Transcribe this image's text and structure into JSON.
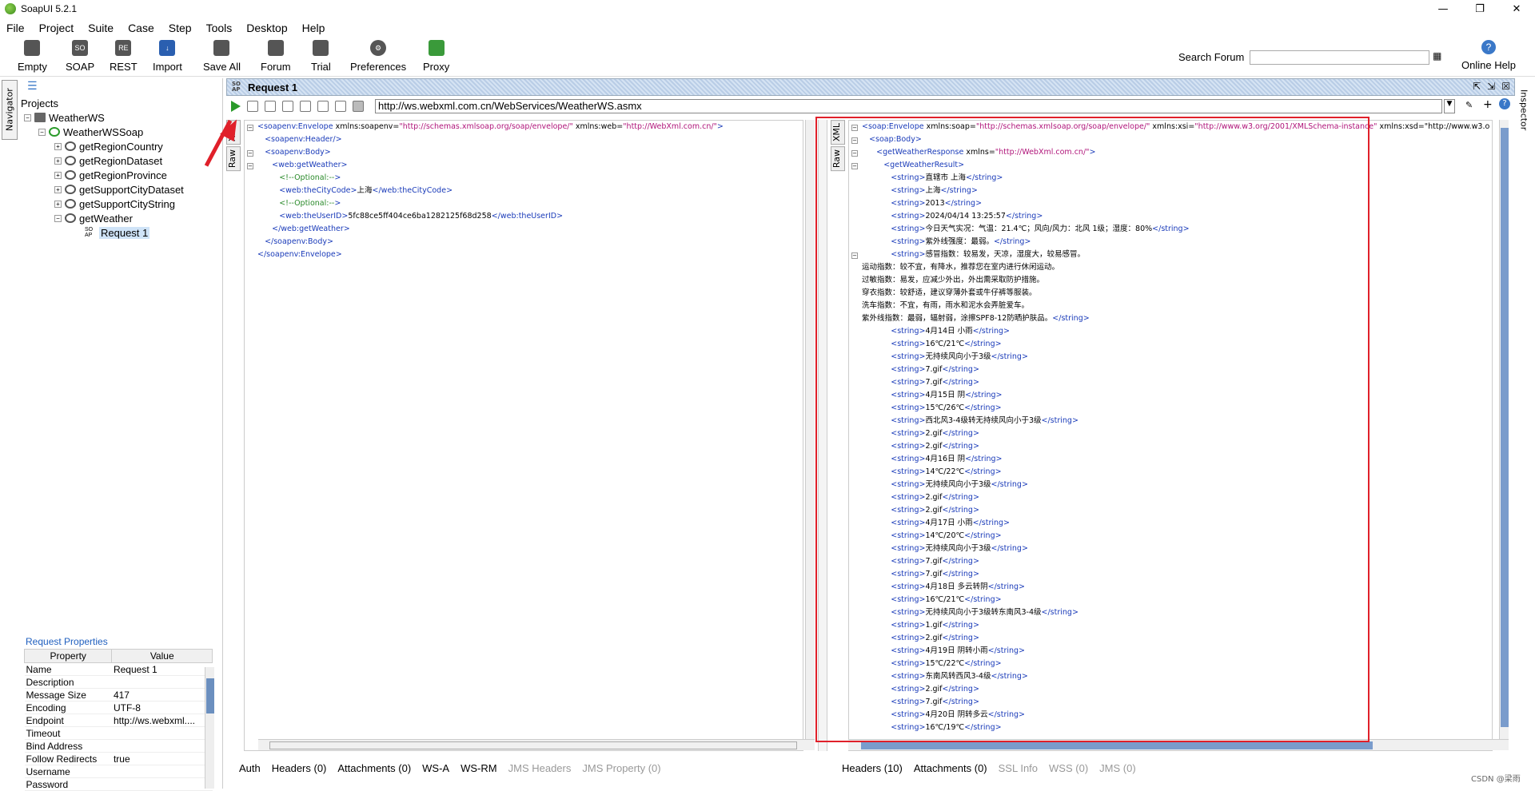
{
  "app": {
    "title": "SoapUI 5.2.1"
  },
  "menu": [
    "File",
    "Project",
    "Suite",
    "Case",
    "Step",
    "Tools",
    "Desktop",
    "Help"
  ],
  "toolbar": {
    "buttons": [
      "Empty",
      "SOAP",
      "REST",
      "Import",
      "Save All",
      "Forum",
      "Trial",
      "Preferences",
      "Proxy"
    ],
    "search_label": "Search Forum",
    "help_label": "Online Help"
  },
  "side": {
    "navigator": "Navigator",
    "inspector": "Inspector"
  },
  "tree": {
    "projects": "Projects",
    "project": "WeatherWS",
    "binding": "WeatherWSSoap",
    "ops": [
      "getRegionCountry",
      "getRegionDataset",
      "getRegionProvince",
      "getSupportCityDataset",
      "getSupportCityString",
      "getWeather"
    ],
    "request": "Request 1"
  },
  "props": {
    "title": "Request Properties",
    "col_property": "Property",
    "col_value": "Value",
    "rows": [
      [
        "Name",
        "Request 1"
      ],
      [
        "Description",
        ""
      ],
      [
        "Message Size",
        "417"
      ],
      [
        "Encoding",
        "UTF-8"
      ],
      [
        "Endpoint",
        "http://ws.webxml...."
      ],
      [
        "Timeout",
        ""
      ],
      [
        "Bind Address",
        ""
      ],
      [
        "Follow Redirects",
        "true"
      ],
      [
        "Username",
        ""
      ],
      [
        "Password",
        ""
      ]
    ]
  },
  "request": {
    "title": "Request 1",
    "endpoint": "http://ws.webxml.com.cn/WebServices/WeatherWS.asmx",
    "left_tabs": [
      "XML",
      "Raw"
    ],
    "right_tabs": [
      "XML",
      "Raw"
    ]
  },
  "req_xml": [
    "<soapenv:Envelope xmlns:soapenv=\"http://schemas.xmlsoap.org/soap/envelope/\" xmlns:web=\"http://WebXml.com.cn/\">",
    "   <soapenv:Header/>",
    "   <soapenv:Body>",
    "      <web:getWeather>",
    "         <!--Optional:-->",
    "         <web:theCityCode>上海</web:theCityCode>",
    "         <!--Optional:-->",
    "         <web:theUserID>5fc88ce5ff404ce6ba1282125f68d258</web:theUserID>",
    "      </web:getWeather>",
    "   </soapenv:Body>",
    "</soapenv:Envelope>"
  ],
  "resp_xml": [
    "<soap:Envelope xmlns:soap=\"http://schemas.xmlsoap.org/soap/envelope/\" xmlns:xsi=\"http://www.w3.org/2001/XMLSchema-instance\" xmlns:xsd=\"http://www.w3.o",
    "   <soap:Body>",
    "      <getWeatherResponse xmlns=\"http://WebXml.com.cn/\">",
    "         <getWeatherResult>",
    "            <string>直辖市 上海</string>",
    "            <string>上海</string>",
    "            <string>2013</string>",
    "            <string>2024/04/14 13:25:57</string>",
    "            <string>今日天气实况：气温：21.4℃；风向/风力：北风 1级；湿度：80%</string>",
    "            <string>紫外线强度：最弱。</string>",
    "            <string>感冒指数：较易发，天凉，湿度大，较易感冒。",
    "运动指数：较不宜，有降水，推荐您在室内进行休闲运动。",
    "过敏指数：易发，应减少外出，外出需采取防护措施。",
    "穿衣指数：较舒适，建议穿薄外套或牛仔裤等服装。",
    "洗车指数：不宜，有雨，雨水和泥水会弄脏爱车。",
    "紫外线指数：最弱，辐射弱，涂擦SPF8-12防晒护肤品。</string>",
    "            <string>4月14日 小雨</string>",
    "            <string>16℃/21℃</string>",
    "            <string>无持续风向小于3级</string>",
    "            <string>7.gif</string>",
    "            <string>7.gif</string>",
    "            <string>4月15日 阴</string>",
    "            <string>15℃/26℃</string>",
    "            <string>西北风3-4级转无持续风向小于3级</string>",
    "            <string>2.gif</string>",
    "            <string>2.gif</string>",
    "            <string>4月16日 阴</string>",
    "            <string>14℃/22℃</string>",
    "            <string>无持续风向小于3级</string>",
    "            <string>2.gif</string>",
    "            <string>2.gif</string>",
    "            <string>4月17日 小雨</string>",
    "            <string>14℃/20℃</string>",
    "            <string>无持续风向小于3级</string>",
    "            <string>7.gif</string>",
    "            <string>7.gif</string>",
    "            <string>4月18日 多云转阴</string>",
    "            <string>16℃/21℃</string>",
    "            <string>无持续风向小于3级转东南风3-4级</string>",
    "            <string>1.gif</string>",
    "            <string>2.gif</string>",
    "            <string>4月19日 阴转小雨</string>",
    "            <string>15℃/22℃</string>",
    "            <string>东南风转西风3-4级</string>",
    "            <string>2.gif</string>",
    "            <string>7.gif</string>",
    "            <string>4月20日 阴转多云</string>",
    "            <string>16℃/19℃</string>"
  ],
  "left_bottom_tabs": [
    "Auth",
    "Headers (0)",
    "Attachments (0)",
    "WS-A",
    "WS-RM",
    "JMS Headers",
    "JMS Property (0)"
  ],
  "right_bottom_tabs": [
    "Headers (10)",
    "Attachments (0)",
    "SSL Info",
    "WSS (0)",
    "JMS (0)"
  ],
  "watermark": "CSDN @梁雨",
  "colors": {
    "annotation": "#e0202a",
    "tag": "#1a3bb9",
    "attr_value": "#b0157a",
    "comment": "#2a8a2a"
  }
}
